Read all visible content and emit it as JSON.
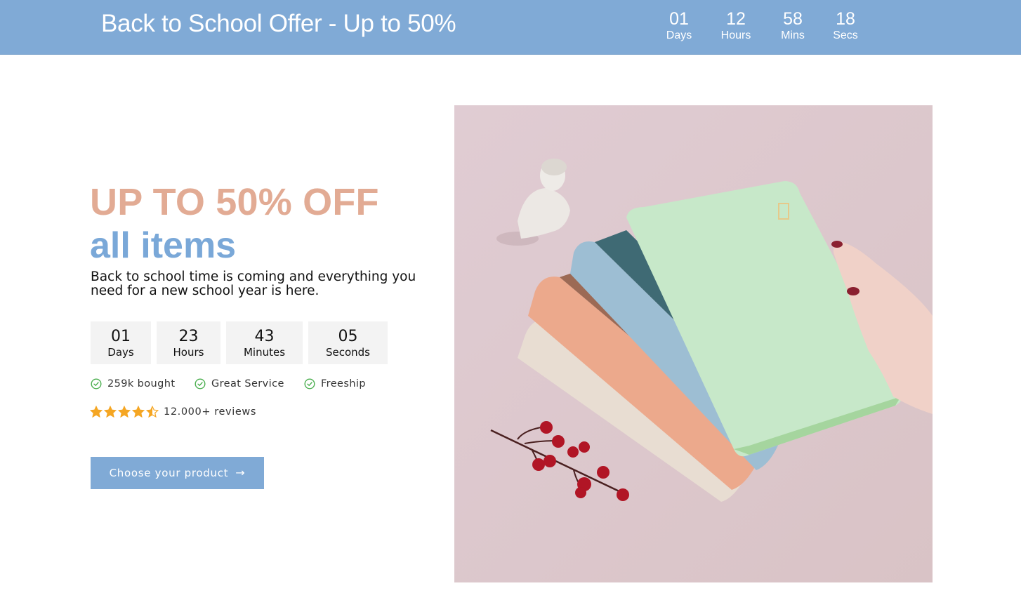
{
  "announcement": {
    "title": "Back to School Offer - Up to 50%",
    "countdown": [
      {
        "value": "01",
        "label": "Days"
      },
      {
        "value": "12",
        "label": "Hours"
      },
      {
        "value": "58",
        "label": "Mins"
      },
      {
        "value": "18",
        "label": "Secs"
      }
    ]
  },
  "hero": {
    "heading": "UP TO 50% OFF",
    "subheading": "all items",
    "description": "Back to school time is coming and everything you need for a new school year is here.",
    "countdown": [
      {
        "value": "01",
        "label": "Days"
      },
      {
        "value": "23",
        "label": "Hours"
      },
      {
        "value": "43",
        "label": "Minutes"
      },
      {
        "value": "05",
        "label": "Seconds"
      }
    ],
    "features": [
      {
        "icon": "check-circle-icon",
        "label": "259k bought"
      },
      {
        "icon": "check-circle-icon",
        "label": "Great Service"
      },
      {
        "icon": "check-circle-icon",
        "label": "Freeship"
      }
    ],
    "rating": {
      "stars": 4.5,
      "max_stars": 5,
      "text": "12.000+ reviews"
    },
    "cta": {
      "label": "Choose your product",
      "icon": "arrow-right-icon"
    },
    "image": {
      "alt": "Pastel notebooks fanned out with a plaster bust and red berries on a pink background"
    }
  },
  "colors": {
    "accent_blue": "#80aad6",
    "heading_peach": "#e2ab94",
    "subheading_blue": "#7aa8d8",
    "check_green": "#4caf50",
    "star_orange": "#f5a623",
    "countdown_box": "#f3f3f3",
    "image_bg": "#dfc9ce"
  }
}
